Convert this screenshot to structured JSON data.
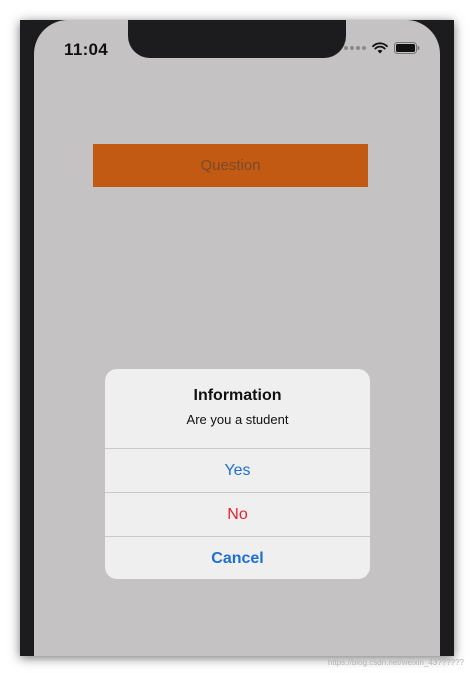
{
  "status_bar": {
    "time": "11:04",
    "icons": [
      "cellular-dots-icon",
      "wifi-icon",
      "battery-icon"
    ]
  },
  "main": {
    "question_button_label": "Question"
  },
  "alert": {
    "title": "Information",
    "message": "Are you a student",
    "actions": [
      {
        "label": "Yes",
        "style": "default",
        "color": "#1f6fd0"
      },
      {
        "label": "No",
        "style": "destructive",
        "color": "#e0242c"
      },
      {
        "label": "Cancel",
        "style": "cancel",
        "color": "#1f6fd0"
      }
    ]
  },
  "colors": {
    "background": "#c4c2c3",
    "accent_button": "#c25a13",
    "alert_background": "#efefef"
  },
  "watermark": "https://blog.csdn.net/weixin_43??????"
}
